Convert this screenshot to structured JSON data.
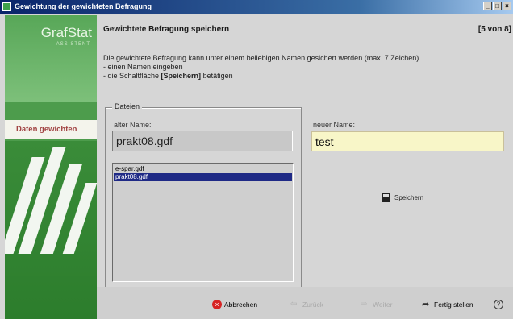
{
  "window": {
    "title": "Gewichtung der gewichteten Befragung",
    "controls": [
      "_",
      "□",
      "×"
    ]
  },
  "sidebar": {
    "brand_title": "GrafStat",
    "brand_subtitle": "ASSISTENT",
    "active_step": "Daten gewichten"
  },
  "header": {
    "title": "Gewichtete Befragung speichern",
    "step": "[5 von 8]"
  },
  "intro": {
    "line1": "Die gewichtete Befragung kann unter einem beliebigen Namen gesichert werden (max. 7 Zeichen)",
    "line2": "- einen Namen eingeben",
    "line3_prefix": "- die Schaltfläche ",
    "line3_bold": "[Speichern]",
    "line3_suffix": " betätigen"
  },
  "files": {
    "legend": "Dateien",
    "old_name_label": "alter Name:",
    "old_name_value": "prakt08.gdf",
    "list": [
      {
        "label": "e-spar.gdf",
        "selected": false
      },
      {
        "label": "prakt08.gdf",
        "selected": true
      }
    ]
  },
  "new_name": {
    "label": "neuer Name:",
    "value": "test"
  },
  "save_button": {
    "label": "Speichern",
    "icon": "floppy-disk-icon"
  },
  "footer": {
    "cancel": "Abbrechen",
    "back": "Zurück",
    "next": "Weiter",
    "finish": "Fertig stellen",
    "help": "?"
  },
  "colors": {
    "sidebar_green": "#4d9c4c",
    "title_bar": "#0a246a",
    "input_background": "#f8f6c8",
    "list_selection": "#1f2a86",
    "active_step_text": "#a14343"
  }
}
